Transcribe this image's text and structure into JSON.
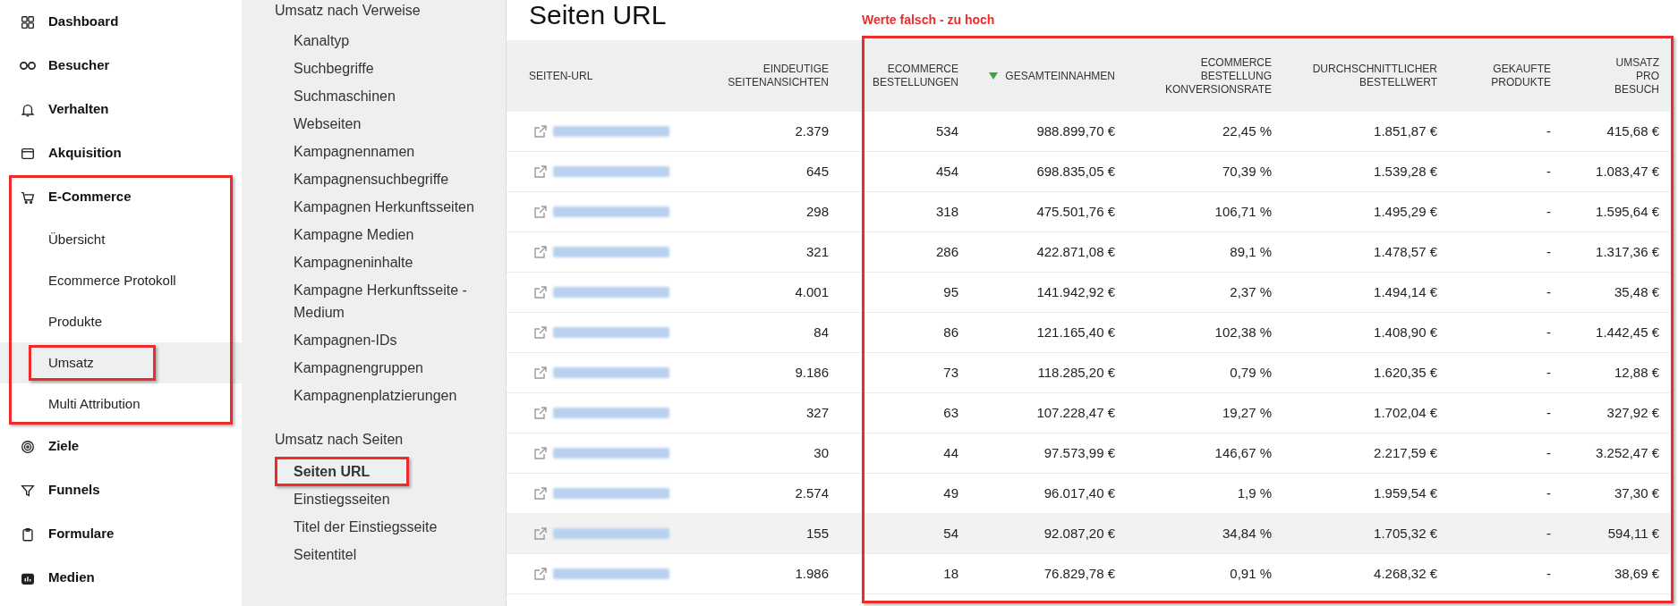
{
  "sidebar": {
    "items": [
      {
        "label": "Dashboard",
        "selected": false,
        "boxed": false
      },
      {
        "label": "Besucher",
        "selected": false,
        "boxed": false
      },
      {
        "label": "Verhalten",
        "selected": false,
        "boxed": false
      },
      {
        "label": "Akquisition",
        "selected": false,
        "boxed": false
      },
      {
        "label": "E-Commerce",
        "selected": false,
        "boxed": true,
        "children": [
          {
            "label": "Übersicht",
            "selected": false,
            "boxed": false
          },
          {
            "label": "Ecommerce Protokoll",
            "selected": false,
            "boxed": false
          },
          {
            "label": "Produkte",
            "selected": false,
            "boxed": false
          },
          {
            "label": "Umsatz",
            "selected": true,
            "boxed": true
          },
          {
            "label": "Multi Attribution",
            "selected": false,
            "boxed": false
          }
        ]
      },
      {
        "label": "Ziele",
        "selected": false,
        "boxed": false
      },
      {
        "label": "Funnels",
        "selected": false,
        "boxed": false
      },
      {
        "label": "Formulare",
        "selected": false,
        "boxed": false
      },
      {
        "label": "Medien",
        "selected": false,
        "boxed": false
      }
    ]
  },
  "subnav": {
    "sections": [
      {
        "title": "Umsatz nach Verweise",
        "items": [
          {
            "label": "Kanaltyp",
            "selected": false,
            "boxed": false
          },
          {
            "label": "Suchbegriffe",
            "selected": false,
            "boxed": false
          },
          {
            "label": "Suchmaschinen",
            "selected": false,
            "boxed": false
          },
          {
            "label": "Webseiten",
            "selected": false,
            "boxed": false
          },
          {
            "label": "Kampagnennamen",
            "selected": false,
            "boxed": false
          },
          {
            "label": "Kampagnensuchbegriffe",
            "selected": false,
            "boxed": false
          },
          {
            "label": "Kampagnen Herkunftsseiten",
            "selected": false,
            "boxed": false
          },
          {
            "label": "Kampagne Medien",
            "selected": false,
            "boxed": false
          },
          {
            "label": "Kampagneninhalte",
            "selected": false,
            "boxed": false
          },
          {
            "label": "Kampagne Herkunftsseite - Medium",
            "selected": false,
            "boxed": false
          },
          {
            "label": "Kampagnen-IDs",
            "selected": false,
            "boxed": false
          },
          {
            "label": "Kampagnengruppen",
            "selected": false,
            "boxed": false
          },
          {
            "label": "Kampagnenplatzierungen",
            "selected": false,
            "boxed": false
          }
        ]
      },
      {
        "title": "Umsatz nach Seiten",
        "items": [
          {
            "label": "Seiten URL",
            "selected": true,
            "boxed": true
          },
          {
            "label": "Einstiegsseiten",
            "selected": false,
            "boxed": false
          },
          {
            "label": "Titel der Einstiegsseite",
            "selected": false,
            "boxed": false
          },
          {
            "label": "Seitentitel",
            "selected": false,
            "boxed": false
          }
        ]
      }
    ]
  },
  "page_title": "Seiten URL",
  "annotation": {
    "note": "Werte falsch - zu hoch",
    "boxed": true
  },
  "table": {
    "columns": [
      {
        "label": "SEITEN-URL",
        "sorted": false
      },
      {
        "label": "EINDEUTIGE SEITENANSICHTEN",
        "sorted": false
      },
      {
        "label": "ECOMMERCE BESTELLUNGEN",
        "sorted": false
      },
      {
        "label": "GESAMTEINNAHMEN",
        "sorted": true
      },
      {
        "label": "ECOMMERCE BESTELLUNG KONVERSIONSRATE",
        "sorted": false
      },
      {
        "label": "DURCHSCHNITTLICHER BESTELLWERT",
        "sorted": false
      },
      {
        "label": "GEKAUFTE PRODUKTE",
        "sorted": false
      },
      {
        "label": "UMSATZ PRO BESUCH",
        "sorted": false
      }
    ],
    "rows": [
      {
        "hovered": false,
        "cells": [
          "",
          "2.379",
          "534",
          "988.899,70 €",
          "22,45 %",
          "1.851,87 €",
          "-",
          "415,68 €"
        ]
      },
      {
        "hovered": false,
        "cells": [
          "",
          "645",
          "454",
          "698.835,05 €",
          "70,39 %",
          "1.539,28 €",
          "-",
          "1.083,47 €"
        ]
      },
      {
        "hovered": false,
        "cells": [
          "",
          "298",
          "318",
          "475.501,76 €",
          "106,71 %",
          "1.495,29 €",
          "-",
          "1.595,64 €"
        ]
      },
      {
        "hovered": false,
        "cells": [
          "",
          "321",
          "286",
          "422.871,08 €",
          "89,1 %",
          "1.478,57 €",
          "-",
          "1.317,36 €"
        ]
      },
      {
        "hovered": false,
        "cells": [
          "",
          "4.001",
          "95",
          "141.942,92 €",
          "2,37 %",
          "1.494,14 €",
          "-",
          "35,48 €"
        ]
      },
      {
        "hovered": false,
        "cells": [
          "",
          "84",
          "86",
          "121.165,40 €",
          "102,38 %",
          "1.408,90 €",
          "-",
          "1.442,45 €"
        ]
      },
      {
        "hovered": false,
        "cells": [
          "",
          "9.186",
          "73",
          "118.285,20 €",
          "0,79 %",
          "1.620,35 €",
          "-",
          "12,88 €"
        ]
      },
      {
        "hovered": false,
        "cells": [
          "",
          "327",
          "63",
          "107.228,47 €",
          "19,27 %",
          "1.702,04 €",
          "-",
          "327,92 €"
        ]
      },
      {
        "hovered": false,
        "cells": [
          "",
          "30",
          "44",
          "97.573,99 €",
          "146,67 %",
          "2.217,59 €",
          "-",
          "3.252,47 €"
        ]
      },
      {
        "hovered": false,
        "cells": [
          "",
          "2.574",
          "49",
          "96.017,40 €",
          "1,9 %",
          "1.959,54 €",
          "-",
          "37,30 €"
        ]
      },
      {
        "hovered": true,
        "cells": [
          "",
          "155",
          "54",
          "92.087,20 €",
          "34,84 %",
          "1.705,32 €",
          "-",
          "594,11 €"
        ]
      },
      {
        "hovered": false,
        "cells": [
          "",
          "1.986",
          "18",
          "76.829,78 €",
          "0,91 %",
          "4.268,32 €",
          "-",
          "38,69 €"
        ]
      }
    ]
  }
}
